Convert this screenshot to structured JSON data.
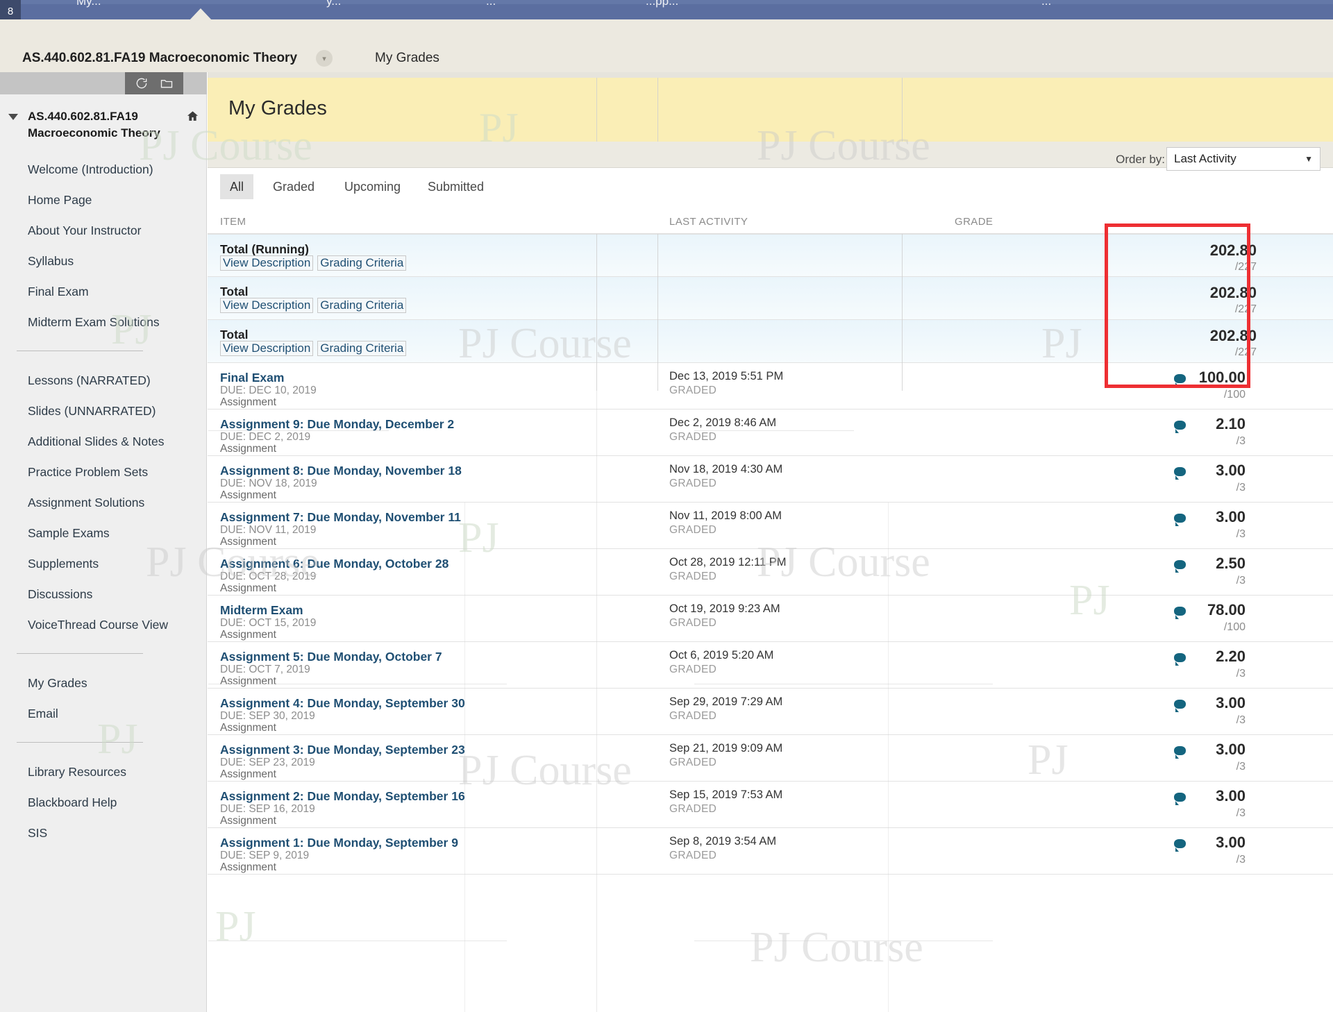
{
  "global_nav": {
    "badge": "8",
    "items": [
      "My...",
      "y...",
      "...",
      "...pp...",
      "..."
    ]
  },
  "breadcrumb": {
    "course": "AS.440.602.81.FA19 Macroeconomic Theory",
    "chevron_icon": "chevron-down-icon",
    "page": "My Grades"
  },
  "sidebar": {
    "toolbar": {
      "refresh_icon": "refresh-icon",
      "folder_icon": "folder-icon"
    },
    "course_title": "AS.440.602.81.FA19 Macroeconomic Theory",
    "home_icon": "home-icon",
    "collapse_icon": "triangle-down-icon",
    "groups": [
      {
        "items": [
          "Welcome (Introduction)",
          "Home Page",
          "About Your Instructor",
          "Syllabus",
          "Final Exam",
          "Midterm Exam Solutions"
        ]
      },
      {
        "items": [
          "Lessons (NARRATED)",
          "Slides (UNNARRATED)",
          "Additional Slides & Notes",
          "Practice Problem Sets",
          "Assignment Solutions",
          "Sample Exams",
          "Supplements",
          "Discussions",
          "VoiceThread Course View"
        ]
      },
      {
        "items": [
          "My Grades",
          "Email"
        ]
      },
      {
        "items": [
          "Library Resources",
          "Blackboard Help",
          "SIS"
        ]
      }
    ]
  },
  "main": {
    "page_title": "My Grades",
    "tabs": [
      {
        "label": "All",
        "active": true
      },
      {
        "label": "Graded",
        "active": false
      },
      {
        "label": "Upcoming",
        "active": false
      },
      {
        "label": "Submitted",
        "active": false
      }
    ],
    "order_by": {
      "label": "Order by:",
      "value": "Last Activity",
      "caret_icon": "caret-down-icon"
    },
    "columns": {
      "item": "ITEM",
      "last_activity": "LAST ACTIVITY",
      "grade": "GRADE"
    },
    "total_rows": [
      {
        "title": "Total (Running)",
        "view_description": "View Description",
        "grading_criteria": "Grading Criteria",
        "score": "202.80",
        "out_of": "/227"
      },
      {
        "title": "Total",
        "view_description": "View Description",
        "grading_criteria": "Grading Criteria",
        "score": "202.80",
        "out_of": "/227"
      },
      {
        "title": "Total",
        "view_description": "View Description",
        "grading_criteria": "Grading Criteria",
        "score": "202.80",
        "out_of": "/227"
      }
    ],
    "item_rows": [
      {
        "title": "Final Exam",
        "due": "DUE: DEC 10, 2019",
        "type": "Assignment",
        "activity": "Dec 13, 2019 5:51 PM",
        "status": "GRADED",
        "score": "100.00",
        "out_of": "/100",
        "comment_icon": "comment-bubble-icon"
      },
      {
        "title": "Assignment 9: Due Monday, December 2",
        "due": "DUE: DEC 2, 2019",
        "type": "Assignment",
        "activity": "Dec 2, 2019 8:46 AM",
        "status": "GRADED",
        "score": "2.10",
        "out_of": "/3",
        "comment_icon": "comment-bubble-icon"
      },
      {
        "title": "Assignment 8: Due Monday, November 18",
        "due": "DUE: NOV 18, 2019",
        "type": "Assignment",
        "activity": "Nov 18, 2019 4:30 AM",
        "status": "GRADED",
        "score": "3.00",
        "out_of": "/3",
        "comment_icon": "comment-bubble-icon"
      },
      {
        "title": "Assignment 7: Due Monday, November 11",
        "due": "DUE: NOV 11, 2019",
        "type": "Assignment",
        "activity": "Nov 11, 2019 8:00 AM",
        "status": "GRADED",
        "score": "3.00",
        "out_of": "/3",
        "comment_icon": "comment-bubble-icon"
      },
      {
        "title": "Assignment 6: Due Monday, October 28",
        "due": "DUE: OCT 28, 2019",
        "type": "Assignment",
        "activity": "Oct 28, 2019 12:11 PM",
        "status": "GRADED",
        "score": "2.50",
        "out_of": "/3",
        "comment_icon": "comment-bubble-icon"
      },
      {
        "title": "Midterm Exam",
        "due": "DUE: OCT 15, 2019",
        "type": "Assignment",
        "activity": "Oct 19, 2019 9:23 AM",
        "status": "GRADED",
        "score": "78.00",
        "out_of": "/100",
        "comment_icon": "comment-bubble-icon"
      },
      {
        "title": "Assignment 5: Due Monday, October 7",
        "due": "DUE: OCT 7, 2019",
        "type": "Assignment",
        "activity": "Oct 6, 2019 5:20 AM",
        "status": "GRADED",
        "score": "2.20",
        "out_of": "/3",
        "comment_icon": "comment-bubble-icon"
      },
      {
        "title": "Assignment 4: Due Monday, September 30",
        "due": "DUE: SEP 30, 2019",
        "type": "Assignment",
        "activity": "Sep 29, 2019 7:29 AM",
        "status": "GRADED",
        "score": "3.00",
        "out_of": "/3",
        "comment_icon": "comment-bubble-icon"
      },
      {
        "title": "Assignment 3: Due Monday, September 23",
        "due": "DUE: SEP 23, 2019",
        "type": "Assignment",
        "activity": "Sep 21, 2019 9:09 AM",
        "status": "GRADED",
        "score": "3.00",
        "out_of": "/3",
        "comment_icon": "comment-bubble-icon"
      },
      {
        "title": "Assignment 2: Due Monday, September 16",
        "due": "DUE: SEP 16, 2019",
        "type": "Assignment",
        "activity": "Sep 15, 2019 7:53 AM",
        "status": "GRADED",
        "score": "3.00",
        "out_of": "/3",
        "comment_icon": "comment-bubble-icon"
      },
      {
        "title": "Assignment 1: Due Monday, September 9",
        "due": "DUE: SEP 9, 2019",
        "type": "Assignment",
        "activity": "Sep 8, 2019 3:54 AM",
        "status": "GRADED",
        "score": "3.00",
        "out_of": "/3",
        "comment_icon": "comment-bubble-icon"
      }
    ]
  },
  "annotation": {
    "highlight_color": "#ee2f33"
  },
  "watermark": {
    "text": "PJ Course",
    "short": "PJ"
  }
}
